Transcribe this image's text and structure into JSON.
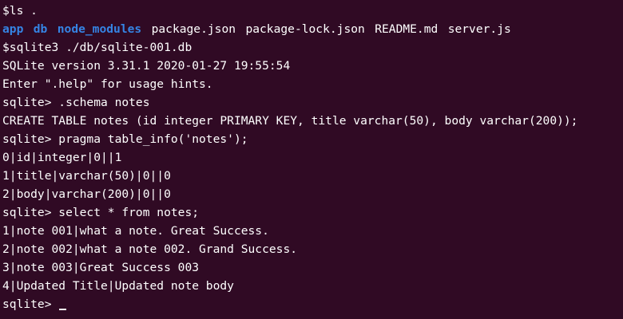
{
  "terminal": {
    "background": "#300a24",
    "foreground": "#ffffff",
    "directory_color": "#3584e4",
    "lines": [
      "$ls .",
      "",
      "$sqlite3 ./db/sqlite-001.db",
      "SQLite version 3.31.1 2020-01-27 19:55:54",
      "Enter \".help\" for usage hints.",
      "sqlite> .schema notes",
      "CREATE TABLE notes (id integer PRIMARY KEY, title varchar(50), body varchar(200));",
      "sqlite> pragma table_info('notes');",
      "0|id|integer|0||1",
      "1|title|varchar(50)|0||0",
      "2|body|varchar(200)|0||0",
      "sqlite> select * from notes;",
      "1|note 001|what a note. Great Success.",
      "2|note 002|what a note 002. Grand Success.",
      "3|note 003|Great Success 003",
      "4|Updated Title|Updated note body",
      "sqlite> "
    ],
    "ls_output": [
      {
        "name": "app",
        "type": "directory"
      },
      {
        "name": "db",
        "type": "directory"
      },
      {
        "name": "node_modules",
        "type": "directory"
      },
      {
        "name": "package.json",
        "type": "file"
      },
      {
        "name": "package-lock.json",
        "type": "file"
      },
      {
        "name": "README.md",
        "type": "file"
      },
      {
        "name": "server.js",
        "type": "file"
      }
    ]
  }
}
